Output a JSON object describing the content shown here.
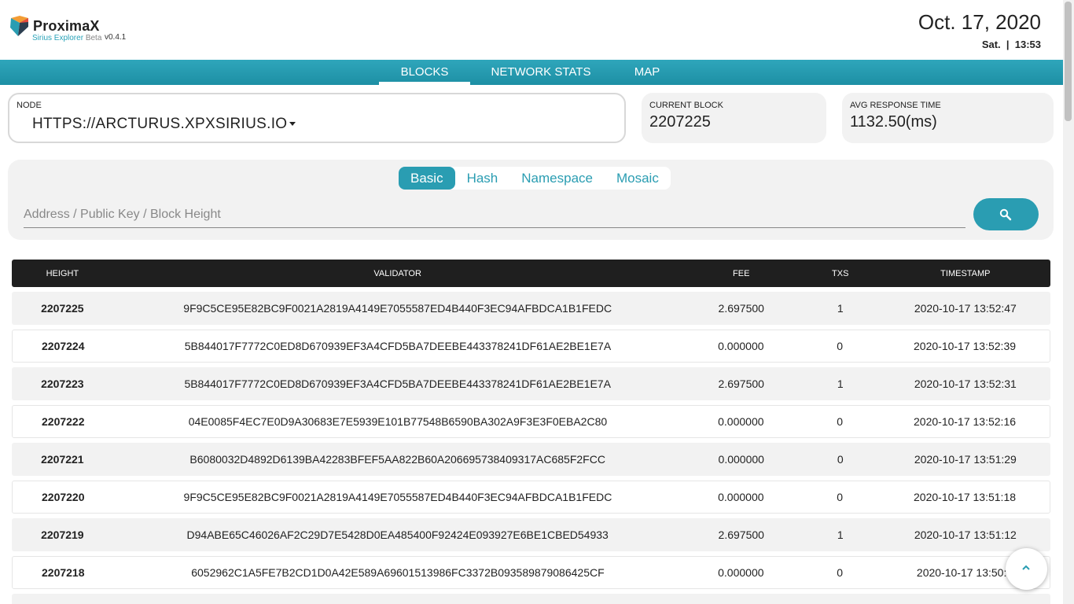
{
  "header": {
    "brand": "ProximaX",
    "subtitle": "Sirius Explorer",
    "beta": "Beta",
    "version": "v0.4.1",
    "date": "Oct. 17, 2020",
    "day_time": "Sat.  |  13:53"
  },
  "nav": {
    "items": [
      "BLOCKS",
      "NETWORK STATS",
      "MAP"
    ],
    "active": "BLOCKS"
  },
  "node": {
    "label": "NODE",
    "value": "HTTPS://ARCTURUS.XPXSIRIUS.IO"
  },
  "current_block": {
    "label": "CURRENT BLOCK",
    "value": "2207225"
  },
  "avg_response": {
    "label": "AVG RESPONSE TIME",
    "value": "1132.50(ms)"
  },
  "search": {
    "tabs": [
      "Basic",
      "Hash",
      "Namespace",
      "Mosaic"
    ],
    "active_tab": "Basic",
    "placeholder": "Address / Public Key / Block Height",
    "button_icon": "search-icon"
  },
  "table": {
    "headers": [
      "HEIGHT",
      "VALIDATOR",
      "FEE",
      "TXS",
      "TIMESTAMP"
    ],
    "rows": [
      [
        "2207225",
        "9F9C5CE95E82BC9F0021A2819A4149E7055587ED4B440F3EC94AFBDCA1B1FEDC",
        "2.697500",
        "1",
        "2020-10-17 13:52:47"
      ],
      [
        "2207224",
        "5B844017F7772C0ED8D670939EF3A4CFD5BA7DEEBE443378241DF61AE2BE1E7A",
        "0.000000",
        "0",
        "2020-10-17 13:52:39"
      ],
      [
        "2207223",
        "5B844017F7772C0ED8D670939EF3A4CFD5BA7DEEBE443378241DF61AE2BE1E7A",
        "2.697500",
        "1",
        "2020-10-17 13:52:31"
      ],
      [
        "2207222",
        "04E0085F4EC7E0D9A30683E7E5939E101B77548B6590BA302A9F3E3F0EBA2C80",
        "0.000000",
        "0",
        "2020-10-17 13:52:16"
      ],
      [
        "2207221",
        "B6080032D4892D6139BA42283BFEF5AA822B60A206695738409317AC685F2FCC",
        "0.000000",
        "0",
        "2020-10-17 13:51:29"
      ],
      [
        "2207220",
        "9F9C5CE95E82BC9F0021A2819A4149E7055587ED4B440F3EC94AFBDCA1B1FEDC",
        "0.000000",
        "0",
        "2020-10-17 13:51:18"
      ],
      [
        "2207219",
        "D94ABE65C46026AF2C29D7E5428D0EA485400F92424E093927E6BE1CBED54933",
        "2.697500",
        "1",
        "2020-10-17 13:51:12"
      ],
      [
        "2207218",
        "6052962C1A5FE7B2CD1D0A42E589A69601513986FC3372B093589879086425CF",
        "0.000000",
        "0",
        "2020-10-17 13:50:5"
      ]
    ]
  },
  "colors": {
    "accent": "#2a9db2",
    "header_dark": "#1f1f1f",
    "row_shade": "#f2f2f2"
  },
  "icons": {
    "logo": "proximax-logo-icon",
    "back_to_top": "chevron-up-icon"
  }
}
